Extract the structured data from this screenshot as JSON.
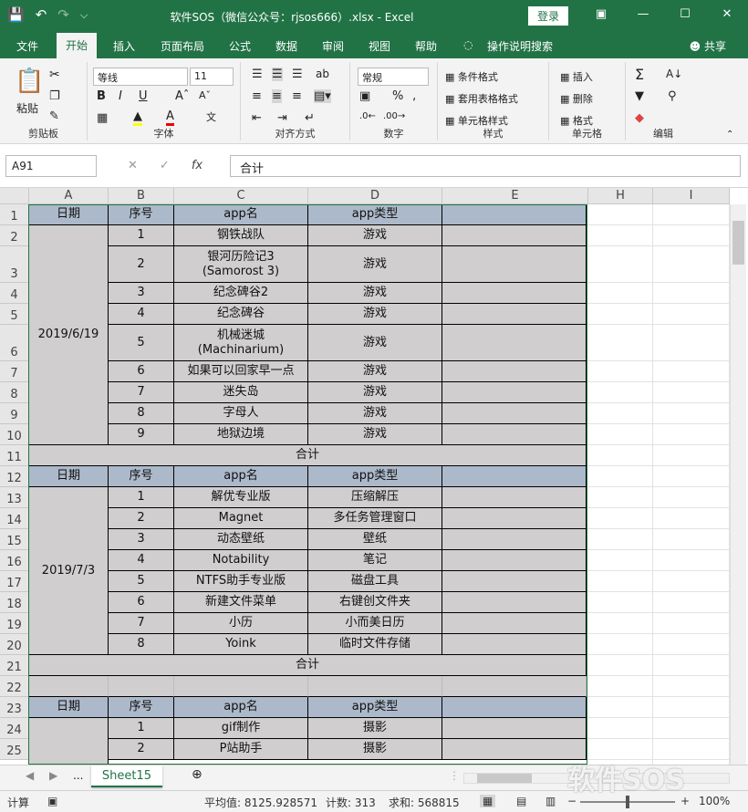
{
  "title": "软件SOS（微信公众号：rjsos666）.xlsx  -  Excel",
  "login": "登录",
  "tabs": [
    "文件",
    "开始",
    "插入",
    "页面布局",
    "公式",
    "数据",
    "审阅",
    "视图",
    "帮助",
    "操作说明搜索"
  ],
  "share": "共享",
  "ribbon": {
    "clipboard": {
      "paste": "粘贴",
      "label": "剪贴板"
    },
    "font": {
      "name": "等线",
      "size": "11",
      "label": "字体",
      "bold": "B",
      "italic": "I",
      "underline": "U"
    },
    "alignment": {
      "label": "对齐方式"
    },
    "number": {
      "format": "常规",
      "label": "数字",
      "percent": "%"
    },
    "styles": {
      "cond": "条件格式",
      "table": "套用表格格式",
      "cell": "单元格样式",
      "label": "样式"
    },
    "cells": {
      "insert": "插入",
      "delete": "删除",
      "format": "格式",
      "label": "单元格"
    },
    "edit": {
      "label": "编辑"
    }
  },
  "namebox": "A91",
  "formula": "合计",
  "fx": "fx",
  "columns": [
    "A",
    "B",
    "C",
    "D",
    "E",
    "H",
    "I"
  ],
  "rows": [
    "1",
    "2",
    "3",
    "4",
    "5",
    "6",
    "7",
    "8",
    "9",
    "10",
    "11",
    "12",
    "13",
    "14",
    "15",
    "16",
    "17",
    "18",
    "19",
    "20",
    "21",
    "22",
    "23",
    "24",
    "25"
  ],
  "headers": [
    "日期",
    "序号",
    "app名",
    "app类型"
  ],
  "date1": "2019/6/19",
  "date2": "2019/7/3",
  "total": "合计",
  "g1": [
    [
      "1",
      "钢铁战队",
      "游戏"
    ],
    [
      "2",
      "银河历险记3\n(Samorost 3)",
      "游戏"
    ],
    [
      "3",
      "纪念碑谷2",
      "游戏"
    ],
    [
      "4",
      "纪念碑谷",
      "游戏"
    ],
    [
      "5",
      "机械迷城\n(Machinarium)",
      "游戏"
    ],
    [
      "6",
      "如果可以回家早一点",
      "游戏"
    ],
    [
      "7",
      "迷失岛",
      "游戏"
    ],
    [
      "8",
      "字母人",
      "游戏"
    ],
    [
      "9",
      "地狱边境",
      "游戏"
    ]
  ],
  "g2": [
    [
      "1",
      "解优专业版",
      "压缩解压"
    ],
    [
      "2",
      "Magnet",
      "多任务管理窗口"
    ],
    [
      "3",
      "动态壁纸",
      "壁纸"
    ],
    [
      "4",
      "Notability",
      "笔记"
    ],
    [
      "5",
      "NTFS助手专业版",
      "磁盘工具"
    ],
    [
      "6",
      "新建文件菜单",
      "右键创文件夹"
    ],
    [
      "7",
      "小历",
      "小而美日历"
    ],
    [
      "8",
      "Yoink",
      "临时文件存储"
    ]
  ],
  "g3": [
    [
      "1",
      "gif制作",
      "摄影"
    ],
    [
      "2",
      "P站助手",
      "摄影"
    ]
  ],
  "sheet": "Sheet15",
  "ellipsis": "...",
  "status": {
    "mode": "计算",
    "avg": "平均值: 8125.928571",
    "count": "计数: 313",
    "sum": "求和: 568815",
    "zoom": "100%"
  },
  "watermark": "软件SOS",
  "colors": {
    "green": "#217346",
    "header": "#acb9ca",
    "body": "#d0cece"
  }
}
